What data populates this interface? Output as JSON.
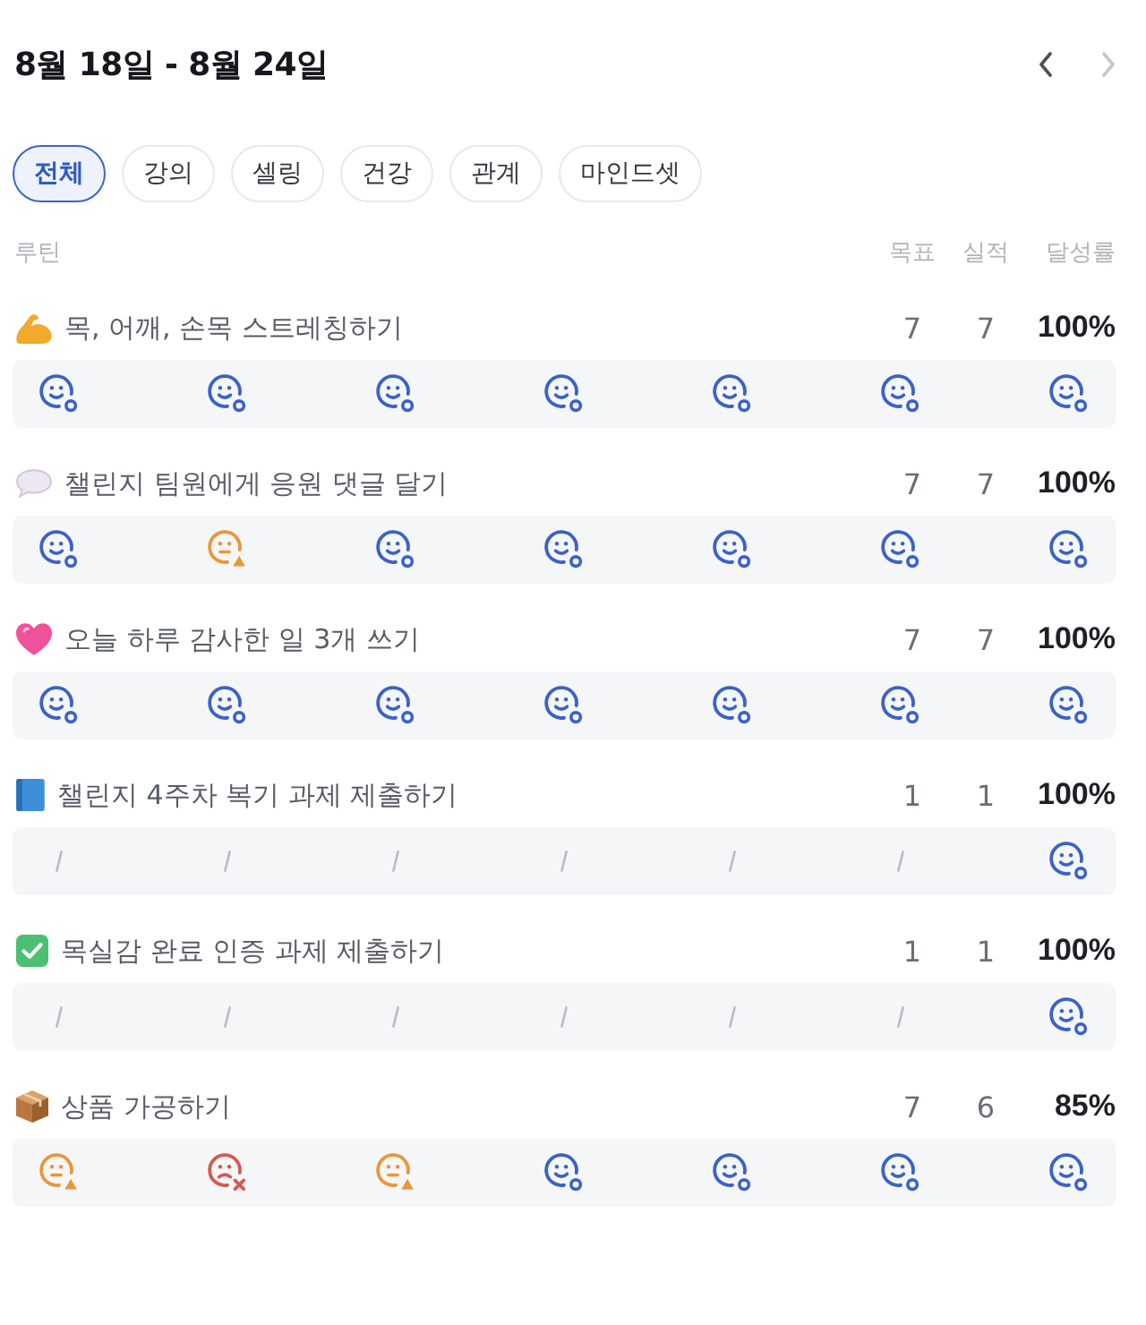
{
  "header": {
    "title": "8월 18일 - 8월 24일",
    "nav": [
      {
        "kind": "prev",
        "disabled": false
      },
      {
        "kind": "next",
        "disabled": true
      }
    ]
  },
  "filters": [
    {
      "label": "전체",
      "selected": true
    },
    {
      "label": "강의",
      "selected": false
    },
    {
      "label": "셀링",
      "selected": false
    },
    {
      "label": "건강",
      "selected": false
    },
    {
      "label": "관계",
      "selected": false
    },
    {
      "label": "마인드셋",
      "selected": false
    }
  ],
  "columns": {
    "routine": "루틴",
    "goal": "목표",
    "actual": "실적",
    "rate": "달성률"
  },
  "routines": [
    {
      "kind": "flexed-arm",
      "title": "목, 어깨, 손목 스트레칭하기",
      "goal": "7",
      "actual": "7",
      "rate": "100%",
      "days": [
        {
          "kind": "done"
        },
        {
          "kind": "done"
        },
        {
          "kind": "done"
        },
        {
          "kind": "done"
        },
        {
          "kind": "done"
        },
        {
          "kind": "done"
        },
        {
          "kind": "done"
        }
      ]
    },
    {
      "kind": "speech-bubble",
      "title": "챌린지 팀원에게 응원 댓글 달기",
      "goal": "7",
      "actual": "7",
      "rate": "100%",
      "days": [
        {
          "kind": "done"
        },
        {
          "kind": "warning"
        },
        {
          "kind": "done"
        },
        {
          "kind": "done"
        },
        {
          "kind": "done"
        },
        {
          "kind": "done"
        },
        {
          "kind": "done"
        }
      ]
    },
    {
      "kind": "heart",
      "title": "오늘 하루 감사한 일 3개 쓰기",
      "goal": "7",
      "actual": "7",
      "rate": "100%",
      "days": [
        {
          "kind": "done"
        },
        {
          "kind": "done"
        },
        {
          "kind": "done"
        },
        {
          "kind": "done"
        },
        {
          "kind": "done"
        },
        {
          "kind": "done"
        },
        {
          "kind": "done"
        }
      ]
    },
    {
      "kind": "book",
      "title": "챌린지 4주차 복기 과제 제출하기",
      "goal": "1",
      "actual": "1",
      "rate": "100%",
      "days": [
        {
          "kind": "none"
        },
        {
          "kind": "none"
        },
        {
          "kind": "none"
        },
        {
          "kind": "none"
        },
        {
          "kind": "none"
        },
        {
          "kind": "none"
        },
        {
          "kind": "done"
        }
      ]
    },
    {
      "kind": "check-box",
      "title": "목실감 완료 인증 과제 제출하기",
      "goal": "1",
      "actual": "1",
      "rate": "100%",
      "days": [
        {
          "kind": "none"
        },
        {
          "kind": "none"
        },
        {
          "kind": "none"
        },
        {
          "kind": "none"
        },
        {
          "kind": "none"
        },
        {
          "kind": "none"
        },
        {
          "kind": "done"
        }
      ]
    },
    {
      "kind": "package",
      "title": "상품 가공하기",
      "goal": "7",
      "actual": "6",
      "rate": "85%",
      "days": [
        {
          "kind": "warning"
        },
        {
          "kind": "missed"
        },
        {
          "kind": "warning"
        },
        {
          "kind": "done"
        },
        {
          "kind": "done"
        },
        {
          "kind": "done"
        },
        {
          "kind": "done"
        }
      ]
    }
  ]
}
